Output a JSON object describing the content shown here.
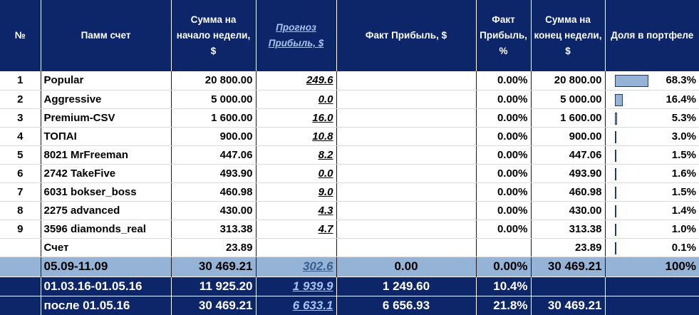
{
  "headers": {
    "num": "№",
    "account": "Памм счет",
    "start_sum": "Сумма на начало недели, $",
    "forecast": "Прогноз Прибыль, $",
    "fact_usd": "Факт Прибыль, $",
    "fact_pct": "Факт Прибыль, %",
    "end_sum": "Сумма на конец недели, $",
    "share": "Доля в портфеле"
  },
  "rows": [
    {
      "num": "1",
      "name": "Popular",
      "start": "20 800.00",
      "forecast": "249.6",
      "fact": "",
      "fact_pct": "0.00%",
      "end": "20 800.00",
      "share": "68.3%",
      "share_value": 0.683
    },
    {
      "num": "2",
      "name": "Aggressive",
      "start": "5 000.00",
      "forecast": "0.0",
      "fact": "",
      "fact_pct": "0.00%",
      "end": "5 000.00",
      "share": "16.4%",
      "share_value": 0.164
    },
    {
      "num": "3",
      "name": "Premium-CSV",
      "start": "1 600.00",
      "forecast": "16.0",
      "fact": "",
      "fact_pct": "0.00%",
      "end": "1 600.00",
      "share": "5.3%",
      "share_value": 0.053
    },
    {
      "num": "4",
      "name": "ТОПАI",
      "start": "900.00",
      "forecast": "10.8",
      "fact": "",
      "fact_pct": "0.00%",
      "end": "900.00",
      "share": "3.0%",
      "share_value": 0.03
    },
    {
      "num": "5",
      "name": "8021 MrFreeman",
      "start": "447.06",
      "forecast": "8.2",
      "fact": "",
      "fact_pct": "0.00%",
      "end": "447.06",
      "share": "1.5%",
      "share_value": 0.015
    },
    {
      "num": "6",
      "name": "2742 TakeFive",
      "start": "493.90",
      "forecast": "0.0",
      "fact": "",
      "fact_pct": "0.00%",
      "end": "493.90",
      "share": "1.6%",
      "share_value": 0.016
    },
    {
      "num": "7",
      "name": "6031 bokser_boss",
      "start": "460.98",
      "forecast": "9.0",
      "fact": "",
      "fact_pct": "0.00%",
      "end": "460.98",
      "share": "1.5%",
      "share_value": 0.015
    },
    {
      "num": "8",
      "name": "2275 advanced",
      "start": "430.00",
      "forecast": "4.3",
      "fact": "",
      "fact_pct": "0.00%",
      "end": "430.00",
      "share": "1.4%",
      "share_value": 0.014
    },
    {
      "num": "9",
      "name": "3596 diamonds_real",
      "start": "313.38",
      "forecast": "4.7",
      "fact": "",
      "fact_pct": "0.00%",
      "end": "313.38",
      "share": "1.0%",
      "share_value": 0.01
    },
    {
      "num": "",
      "name": "Счет",
      "start": "23.89",
      "forecast": "",
      "fact": "",
      "fact_pct": "",
      "end": "23.89",
      "share": "0.1%",
      "share_value": 0.001
    }
  ],
  "total": {
    "period": "05.09-11.09",
    "start": "30 469.21",
    "forecast": "302.6",
    "fact": "0.00",
    "fact_pct": "0.00%",
    "end": "30 469.21",
    "share": "100%"
  },
  "summary": [
    {
      "period": "01.03.16-01.05.16",
      "start": "11 925.20",
      "forecast": "1 939.9",
      "fact": "1 249.60",
      "fact_pct": "10.4%",
      "end": ""
    },
    {
      "period": "после 01.05.16",
      "start": "30 469.21",
      "forecast": "6 633.1",
      "fact": "6 656.93",
      "fact_pct": "21.8%",
      "end": "30 469.21"
    }
  ],
  "colors": {
    "header_bg": "#0d2569",
    "total_bg": "#95b3d7",
    "bar_fill": "#95b3d7",
    "link": "#365f91"
  }
}
